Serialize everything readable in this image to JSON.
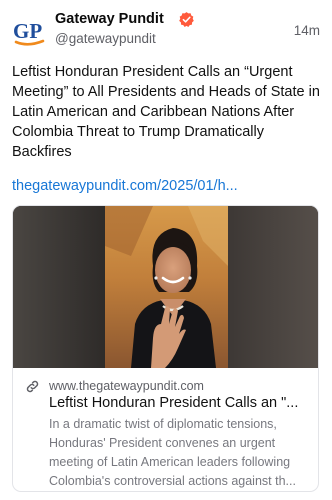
{
  "post": {
    "author": {
      "name": "Gateway Pundit",
      "handle": "@gatewaypundit",
      "avatar_text": "GP",
      "verified": true
    },
    "timestamp": "14m",
    "text": "Leftist Honduran President Calls an “Urgent Meeting” to All Presidents and Heads of State in Latin American and Caribbean Nations After Colombia Threat to Trump Dramatically Backfires",
    "link_text": "thegatewaypundit.com/2025/01/h..."
  },
  "link_card": {
    "domain": "www.thegatewaypundit.com",
    "title": "Leftist Honduran President Calls an \"...",
    "description": "In a dramatic twist of diplomatic tensions, Honduras' President convenes an urgent meeting of Latin American leaders following Colombia's controversial actions against th..."
  },
  "colors": {
    "link": "#1877d6",
    "verified_badge": "#ff5a3c",
    "brand_blue": "#1f4e9c",
    "brand_orange": "#f08a1c",
    "secondary_text": "#5f6066"
  }
}
